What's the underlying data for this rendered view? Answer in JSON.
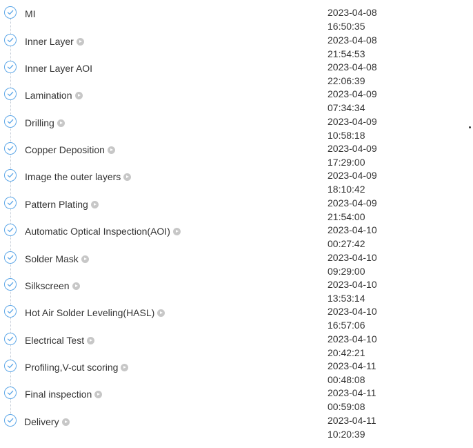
{
  "steps": [
    {
      "name": "MI",
      "date": "2023-04-08",
      "time": "16:50:35",
      "has_play": false
    },
    {
      "name": "Inner Layer",
      "date": "2023-04-08",
      "time": "21:54:53",
      "has_play": true
    },
    {
      "name": "Inner Layer AOI",
      "date": "2023-04-08",
      "time": "22:06:39",
      "has_play": false
    },
    {
      "name": "Lamination",
      "date": "2023-04-09",
      "time": "07:34:34",
      "has_play": true
    },
    {
      "name": "Drilling",
      "date": "2023-04-09",
      "time": "10:58:18",
      "has_play": true
    },
    {
      "name": "Copper Deposition",
      "date": "2023-04-09",
      "time": "17:29:00",
      "has_play": true
    },
    {
      "name": "Image the outer layers",
      "date": "2023-04-09",
      "time": "18:10:42",
      "has_play": true
    },
    {
      "name": "Pattern Plating",
      "date": "2023-04-09",
      "time": "21:54:00",
      "has_play": true
    },
    {
      "name": "Automatic Optical Inspection(AOI)",
      "date": "2023-04-10",
      "time": "00:27:42",
      "has_play": true
    },
    {
      "name": "Solder Mask",
      "date": "2023-04-10",
      "time": "09:29:00",
      "has_play": true
    },
    {
      "name": "Silkscreen",
      "date": "2023-04-10",
      "time": "13:53:14",
      "has_play": true
    },
    {
      "name": "Hot Air Solder Leveling(HASL)",
      "date": "2023-04-10",
      "time": "16:57:06",
      "has_play": true
    },
    {
      "name": "Electrical Test",
      "date": "2023-04-10",
      "time": "20:42:21",
      "has_play": true
    },
    {
      "name": "Profiling,V-cut scoring",
      "date": "2023-04-11",
      "time": "00:48:08",
      "has_play": true
    },
    {
      "name": "Final inspection",
      "date": "2023-04-11",
      "time": "00:59:08",
      "has_play": true
    },
    {
      "name": "Delivery",
      "date": "2023-04-11",
      "time": "10:20:39",
      "has_play": true
    }
  ],
  "icons": {
    "status": "check-circle-icon",
    "detail": "play-circle-icon"
  },
  "colors": {
    "check_accent": "#5fa8e8",
    "play_icon": "#c7c7c7",
    "text": "#333333"
  }
}
